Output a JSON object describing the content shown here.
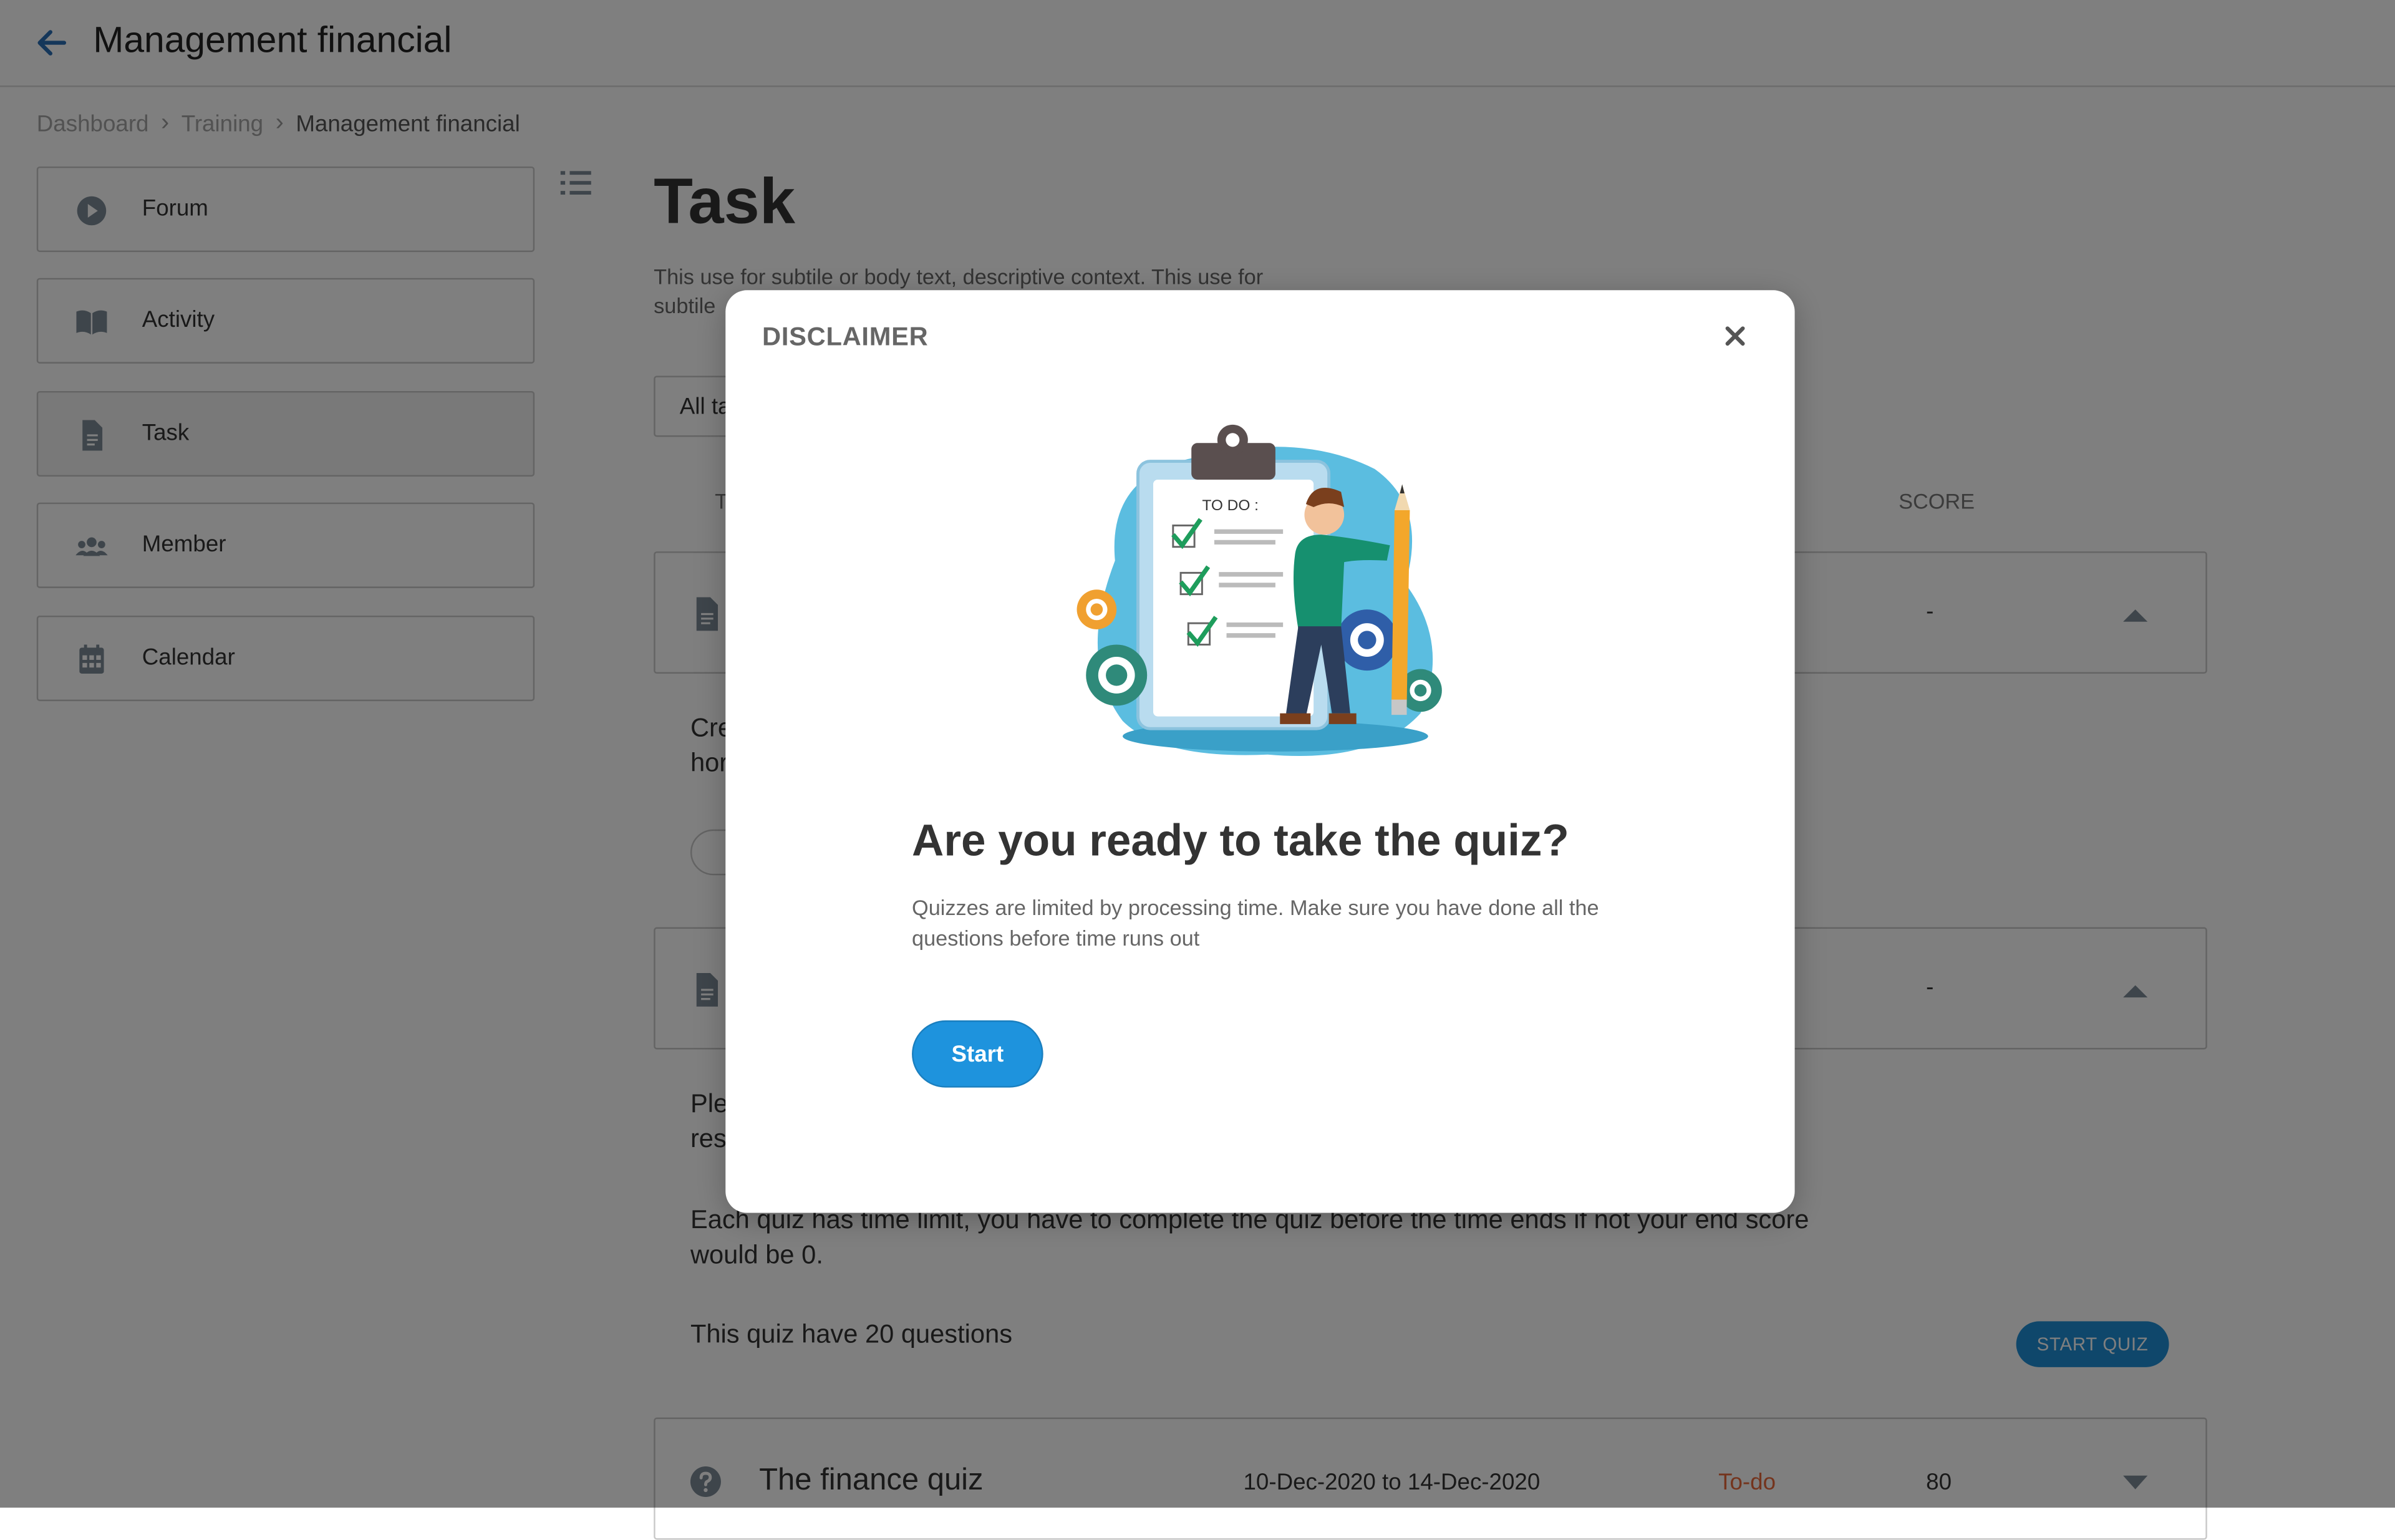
{
  "header": {
    "title": "Management financial",
    "back_icon": "arrow-left-icon"
  },
  "breadcrumb": {
    "items": [
      "Dashboard",
      "Training"
    ],
    "current": "Management financial",
    "separator": "›"
  },
  "sidebar": {
    "items": [
      {
        "label": "Forum",
        "icon": "play-circle-icon"
      },
      {
        "label": "Activity",
        "icon": "book-open-icon"
      },
      {
        "label": "Task",
        "icon": "document-icon",
        "active": true
      },
      {
        "label": "Member",
        "icon": "group-icon"
      },
      {
        "label": "Calendar",
        "icon": "calendar-icon"
      }
    ],
    "toggle_icon": "list-icon"
  },
  "main": {
    "title": "Task",
    "description": "This use for subtile or body text, descriptive context. This use for subtile",
    "filter": {
      "value": "All ta"
    },
    "columns": {
      "title": "T",
      "score": "SCORE"
    },
    "rows": [
      {
        "score": "-",
        "text": "Cre\nhor",
        "expanded": true
      },
      {
        "score": "-",
        "text": "Ple\nres",
        "expanded": true
      }
    ],
    "time_limit_text": "Each quiz has time limit, you have to complete the quiz before the time ends if not your end score would be 0.",
    "quiz_info": "This quiz have 20 questions",
    "start_quiz_label": "START QUIZ",
    "finance_quiz": {
      "title": "The finance quiz",
      "dates": "10-Dec-2020 to 14-Dec-2020",
      "status": "To-do",
      "score": "80"
    }
  },
  "modal": {
    "title": "DISCLAIMER",
    "illustration_label": "TO DO :",
    "heading": "Are you ready to take the quiz?",
    "text": "Quizzes are limited by processing time. Make sure you have done all the questions before time runs out",
    "start_label": "Start",
    "close_icon": "close-icon"
  },
  "colors": {
    "primary": "#1e93dd",
    "status_todo": "#e8683a",
    "overlay": "rgba(0,0,0,0.5)"
  }
}
